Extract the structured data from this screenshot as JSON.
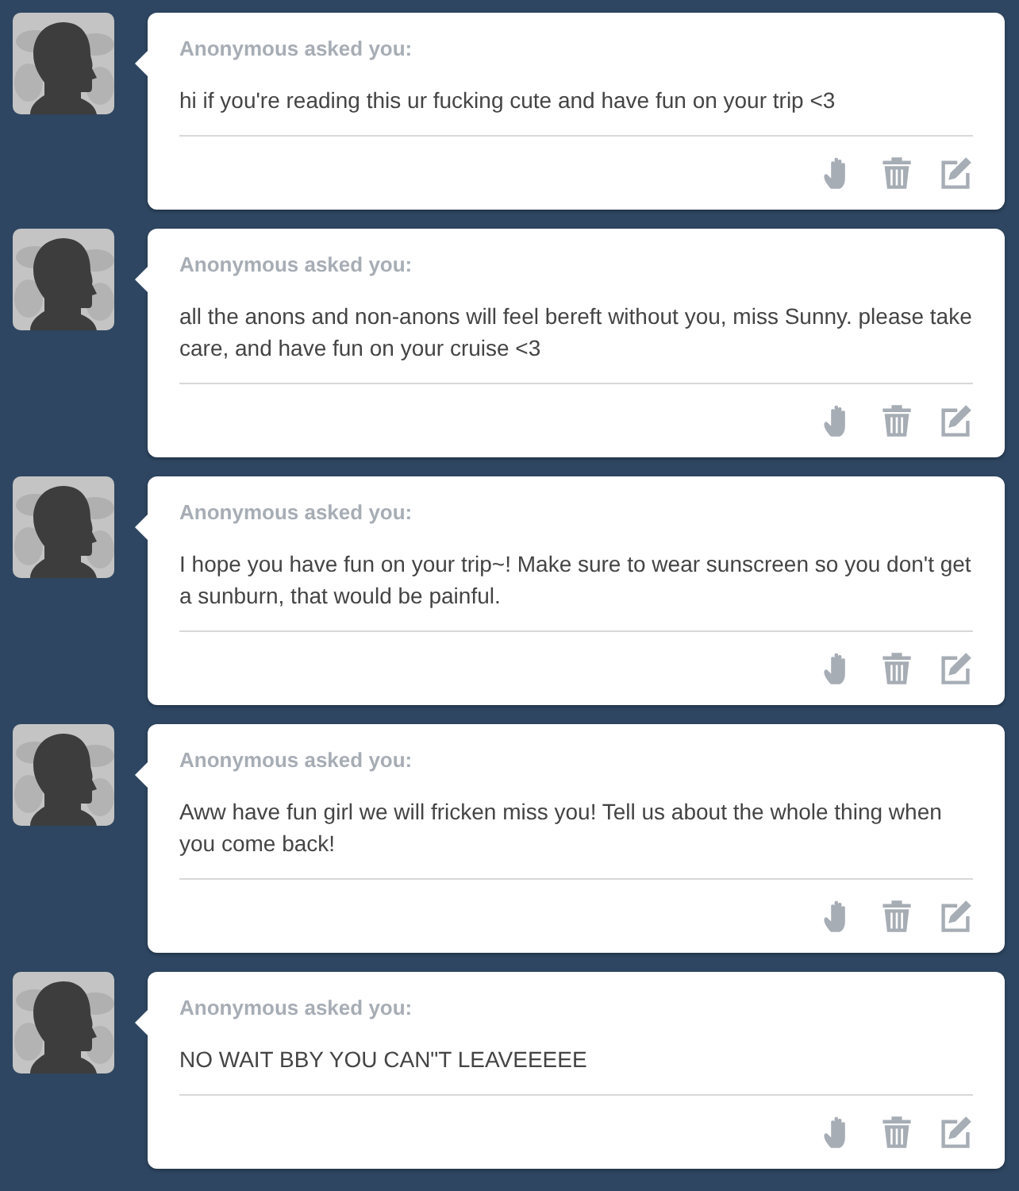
{
  "asks": [
    {
      "asker": "Anonymous asked you:",
      "question": "hi if you're reading this ur fucking cute and have fun on your trip <3"
    },
    {
      "asker": "Anonymous asked you:",
      "question": "all the anons and non-anons will feel bereft without you, miss Sunny. please take care, and have fun on your cruise <3"
    },
    {
      "asker": "Anonymous asked you:",
      "question": "I hope you have fun on your trip~! Make sure to wear sunscreen so you don't get a sunburn, that would be painful."
    },
    {
      "asker": "Anonymous asked you:",
      "question": "Aww have fun girl we will fricken miss you! Tell us about the whole thing when you come back!"
    },
    {
      "asker": "Anonymous asked you:",
      "question": "NO WAIT BBY YOU CAN\"T LEAVEEEEE"
    }
  ]
}
